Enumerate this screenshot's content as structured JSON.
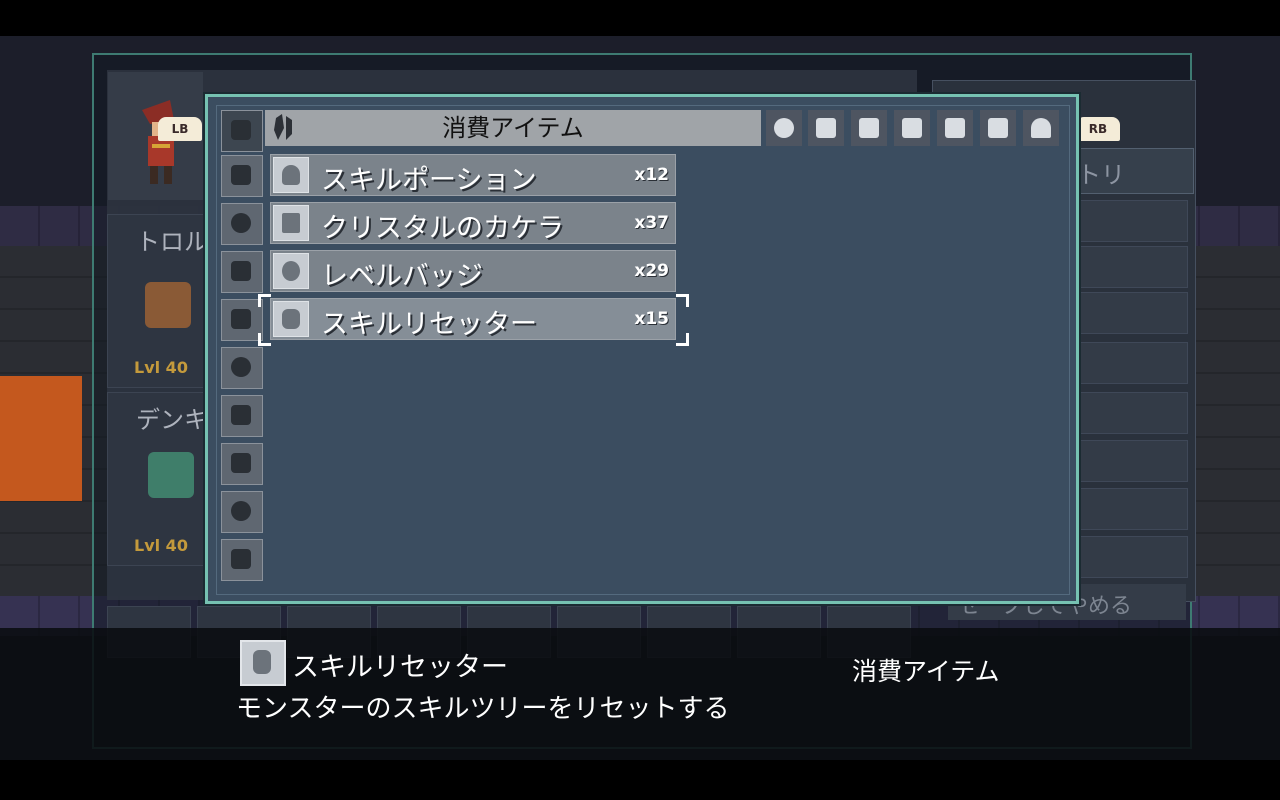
{
  "modal": {
    "header_title": "消費アイテム",
    "items": [
      {
        "name": "スキルポーション",
        "count": "x12",
        "icon": "potion-icon"
      },
      {
        "name": "クリスタルのカケラ",
        "count": "x37",
        "icon": "crystal-shard-icon"
      },
      {
        "name": "レベルバッジ",
        "count": "x29",
        "icon": "badge-icon"
      },
      {
        "name": "スキルリセッター",
        "count": "x15",
        "icon": "gem-icon"
      }
    ],
    "selected_index": 3,
    "category_icons": [
      "drop-icon",
      "box-icon",
      "orb-icon",
      "box-icon",
      "box-icon",
      "ring-icon",
      "box-icon",
      "box-icon",
      "bomb-icon",
      "box-icon"
    ],
    "tab_icons": [
      "bomb-icon",
      "bottle-icon",
      "hammer-icon",
      "sparkle-icon",
      "key-icon",
      "sword-icon",
      "helmet-icon"
    ]
  },
  "buttons": {
    "lb": "LB",
    "rb": "RB"
  },
  "background": {
    "party_names": [
      "トロル",
      "デンキ"
    ],
    "party_levels": [
      "Lvl 40",
      "Lvl 40"
    ],
    "right_tab": "インベントリ",
    "right_bottom": "セーブしてやめる"
  },
  "description": {
    "item_name": "スキルリセッター",
    "category": "消費アイテム",
    "text": "モンスターのスキルツリーをリセットする"
  },
  "colors": {
    "modal_border": "#76c2b2",
    "modal_bg": "#3b4d60",
    "lvl_gold": "#c49a3c"
  }
}
